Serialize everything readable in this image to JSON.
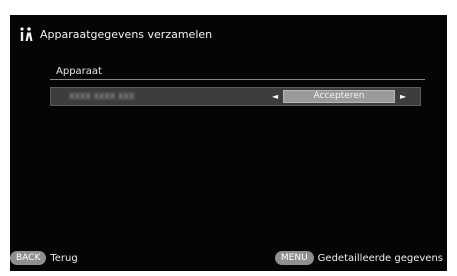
{
  "header": {
    "title": "Apparaatgegevens verzamelen",
    "icon": "info-person-icon"
  },
  "section": {
    "label": "Apparaat"
  },
  "device_row": {
    "device_name": "XXXX XXXX XXX",
    "left_arrow": "◄",
    "right_arrow": "►",
    "action_label": "Accepteren"
  },
  "footer": {
    "back_key": "BACK",
    "back_label": "Terug",
    "menu_key": "MENU",
    "menu_label": "Gedetailleerde gegevens"
  },
  "colors": {
    "background": "#050505",
    "row_background": "#3d3d3d",
    "button_background": "#9b9b9b",
    "key_pill": "#8f8f8f"
  }
}
